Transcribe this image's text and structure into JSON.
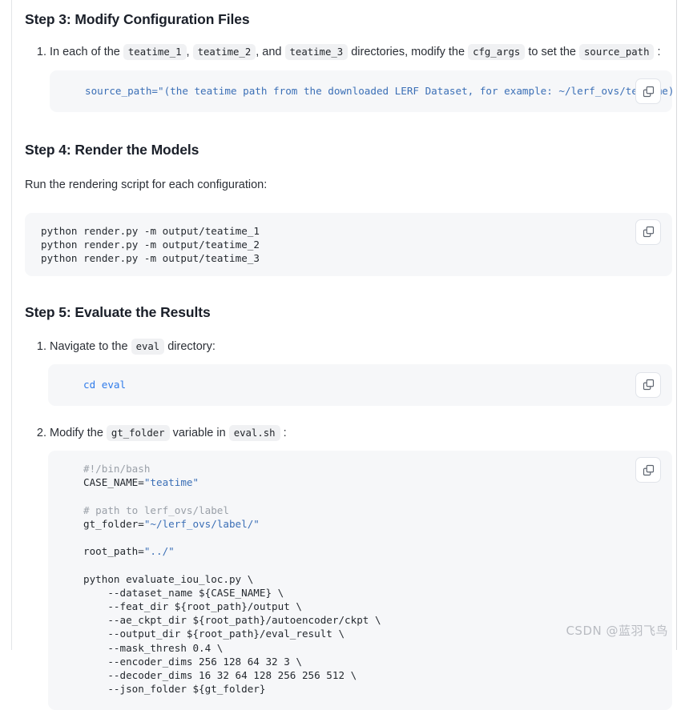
{
  "sections": [
    {
      "heading": "Step 3: Modify Configuration Files",
      "list_items": [
        {
          "prefix": "In each of the ",
          "code1": "teatime_1",
          "sep1": ",",
          "code2": "teatime_2",
          "sep2": ", and",
          "code3": "teatime_3",
          "mid": " directories, modify the ",
          "code4": "cfg_args",
          "mid2": " to set the ",
          "code5": "source_path",
          "suffix": ":"
        }
      ],
      "code": {
        "line": "source_path=\"(the teatime path from the downloaded LERF Dataset, for example: ~/lerf_ovs/teatime)\"",
        "copy_label": "copy-icon"
      }
    },
    {
      "heading": "Step 4: Render the Models",
      "paragraph": "Run the rendering script for each configuration:",
      "code_lines": [
        "python render.py -m output/teatime_1",
        "python render.py -m output/teatime_2",
        "python render.py -m output/teatime_3"
      ]
    },
    {
      "heading": "Step 5: Evaluate the Results",
      "item1": {
        "prefix": "Navigate to the ",
        "code": "eval",
        "suffix": " directory:"
      },
      "item1_code": "cd eval",
      "item2": {
        "prefix": "Modify the ",
        "code1": "gt_folder",
        "mid": " variable in ",
        "code2": "eval.sh",
        "suffix": ":"
      },
      "item2_code": {
        "l1_comment": "#!/bin/bash",
        "l2_name": "CASE_NAME=",
        "l2_str": "\"teatime\"",
        "l3_blank": "",
        "l4_comment": "# path to lerf_ovs/label",
        "l5_name": "gt_folder=",
        "l5_str": "\"~/lerf_ovs/label/\"",
        "l6_blank": "",
        "l7_name": "root_path=",
        "l7_str": "\"../\"",
        "l8_blank": "",
        "l9": "python evaluate_iou_loc.py \\",
        "l10": "    --dataset_name ${CASE_NAME} \\",
        "l11": "    --feat_dir ${root_path}/output \\",
        "l12": "    --ae_ckpt_dir ${root_path}/autoencoder/ckpt \\",
        "l13": "    --output_dir ${root_path}/eval_result \\",
        "l14": "    --mask_thresh 0.4 \\",
        "l15": "    --encoder_dims 256 128 64 32 3 \\",
        "l16": "    --decoder_dims 16 32 64 128 256 256 512 \\",
        "l17": "    --json_folder ${gt_folder}"
      }
    }
  ],
  "watermark": "CSDN @蓝羽飞鸟",
  "colors": {
    "code_bg": "#f6f7f9",
    "inline_code_bg": "#f0f1f3",
    "string_blue": "#3b6fb6",
    "comment_gray": "#9aa0a8",
    "accent_blue": "#2f7bea",
    "heading": "#1a1f29"
  }
}
